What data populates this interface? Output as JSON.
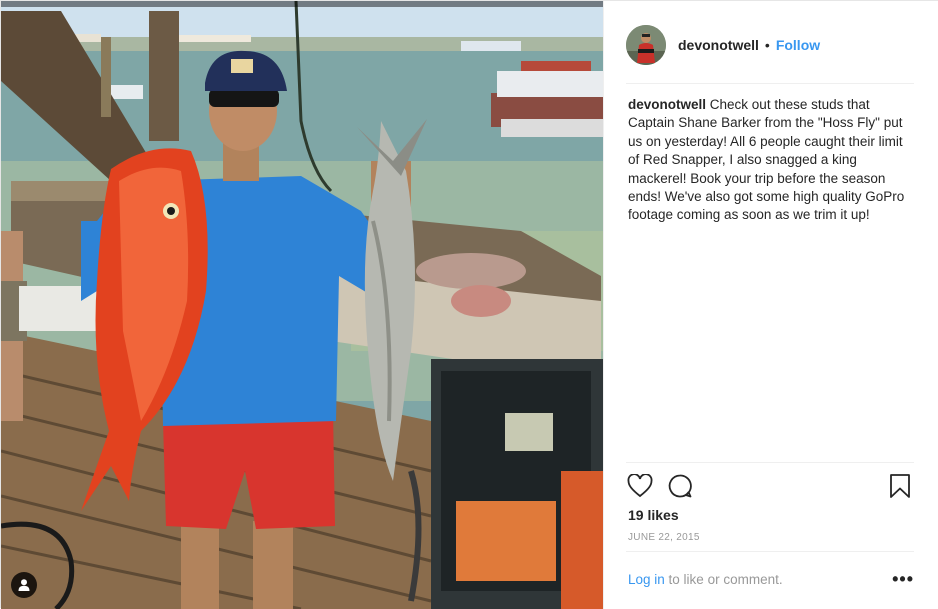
{
  "post": {
    "username": "devonotwell",
    "follow_label": "Follow",
    "dot": "•",
    "caption_user": "devonotwell",
    "caption_text": "Check out these studs that Captain Shane Barker from the \"Hoss Fly\" put us on yesterday! All 6 people caught their limit of Red Snapper, I also snagged a king mackerel! Book your trip before the season ends! We've also got some high quality GoPro footage coming as soon as we trim it up!",
    "likes": "19 likes",
    "date": "JUNE 22, 2015",
    "login_link": "Log in",
    "login_suffix": " to like or comment.",
    "more_label": "•••"
  },
  "icons": {
    "like": "heart-icon",
    "comment": "comment-bubble-icon",
    "save": "bookmark-icon",
    "user_tag": "user-tag-icon"
  },
  "colors": {
    "link": "#3897f0",
    "text": "#262626",
    "muted": "#999999",
    "divider": "#efefef"
  }
}
